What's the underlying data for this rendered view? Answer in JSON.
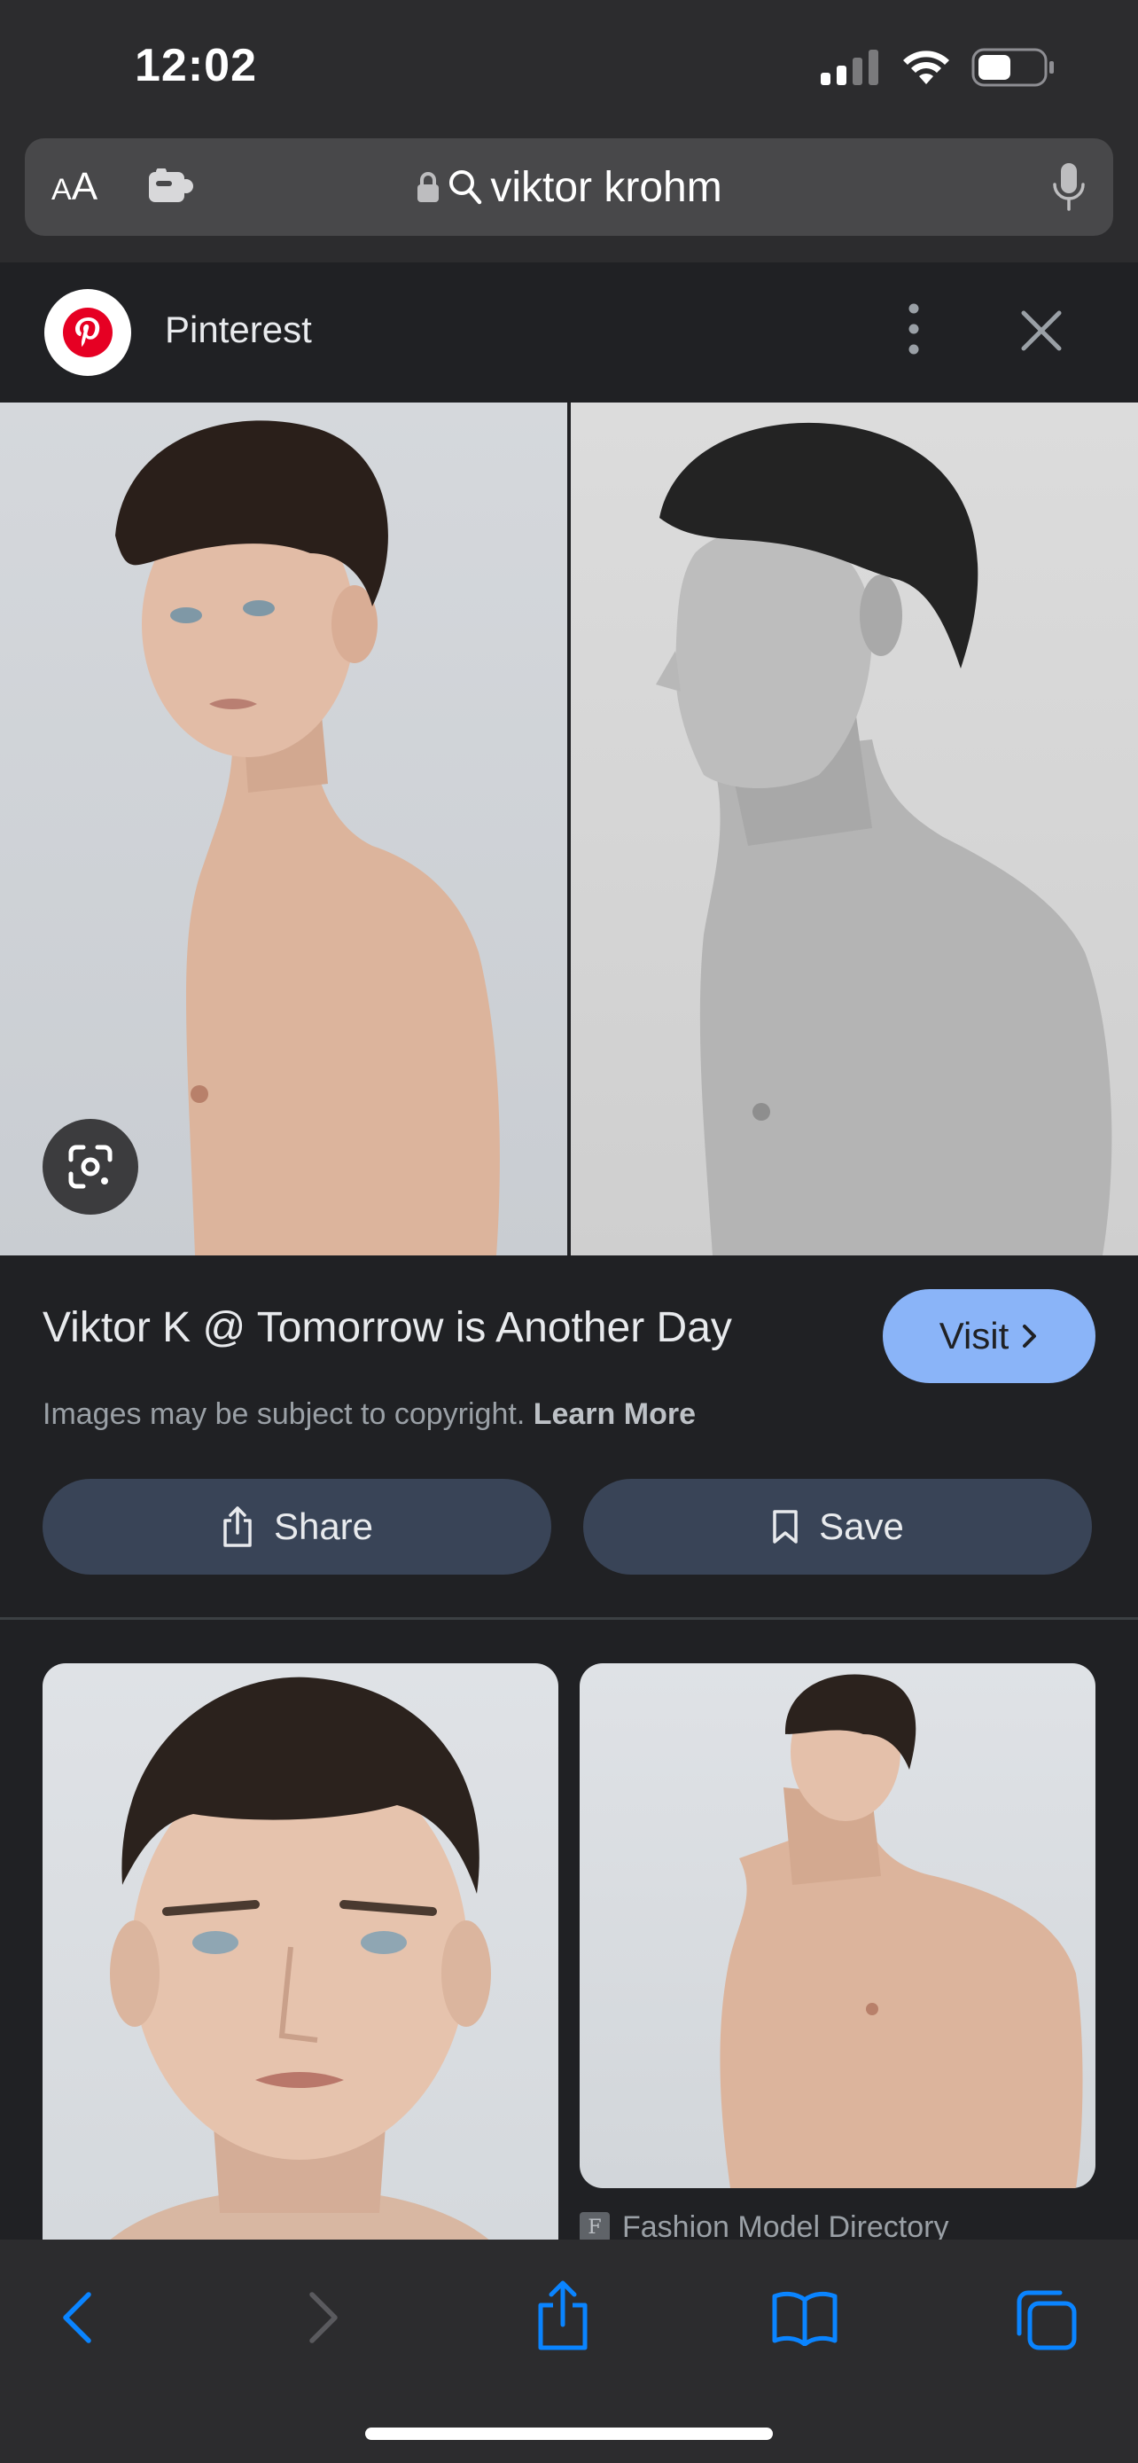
{
  "status_bar": {
    "time": "12:02",
    "signal_icon": "cellular-signal-icon",
    "wifi_icon": "wifi-icon",
    "battery_icon": "battery-icon"
  },
  "address_bar": {
    "aa_small": "A",
    "aa_big": "A",
    "extension_icon": "extension-icon",
    "lock_icon": "lock-icon",
    "search_icon": "search-icon",
    "query": "viktor krohm",
    "mic_icon": "mic-icon"
  },
  "source": {
    "name": "Pinterest",
    "logo_icon": "pinterest-logo-icon",
    "more_icon": "more-vertical-icon",
    "close_icon": "close-icon"
  },
  "result": {
    "title": "Viktor K @ Tomorrow is Another Day",
    "visit_label": "Visit",
    "copyright_text": "Images may be subject to copyright.",
    "learn_more": "Learn More",
    "share_label": "Share",
    "save_label": "Save",
    "lens_icon": "google-lens-icon"
  },
  "related": {
    "items": [
      {
        "source": ""
      },
      {
        "source": "Fashion Model Directory",
        "favicon_letter": "F"
      }
    ]
  },
  "toolbar": {
    "back_icon": "back-icon",
    "forward_icon": "forward-icon",
    "share_icon": "share-icon",
    "bookmarks_icon": "bookmarks-icon",
    "tabs_icon": "tabs-icon"
  },
  "colors": {
    "accent": "#8ab4f8",
    "action_button": "#394457",
    "background": "#202124",
    "ios_blue": "#0a84ff"
  }
}
